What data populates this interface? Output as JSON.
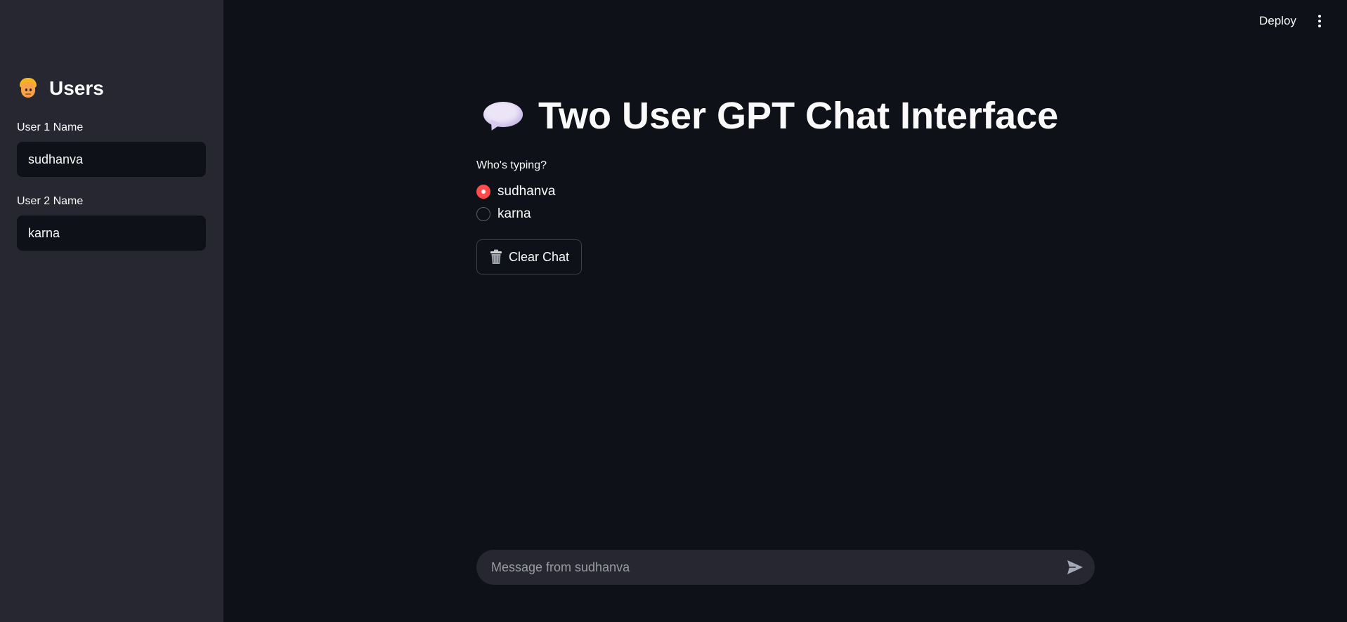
{
  "sidebar": {
    "heading": "Users",
    "heading_icon": "user-emoji-icon",
    "user1": {
      "label": "User 1 Name",
      "value": "sudhanva"
    },
    "user2": {
      "label": "User 2 Name",
      "value": "karna"
    }
  },
  "header": {
    "deploy_label": "Deploy",
    "menu_icon": "vertical-dots-icon"
  },
  "main": {
    "title": "Two User GPT Chat Interface",
    "title_icon": "speech-bubble-icon",
    "radio": {
      "label": "Who's typing?",
      "options": [
        "sudhanva",
        "karna"
      ],
      "selected": "sudhanva"
    },
    "clear_button_label": "Clear Chat",
    "clear_button_icon": "trash-icon"
  },
  "chat": {
    "placeholder": "Message from sudhanva",
    "send_icon": "send-icon"
  },
  "colors": {
    "accent": "#ff4b4b",
    "background": "#0e1117",
    "sidebar": "#262730",
    "text": "#fafafa"
  }
}
